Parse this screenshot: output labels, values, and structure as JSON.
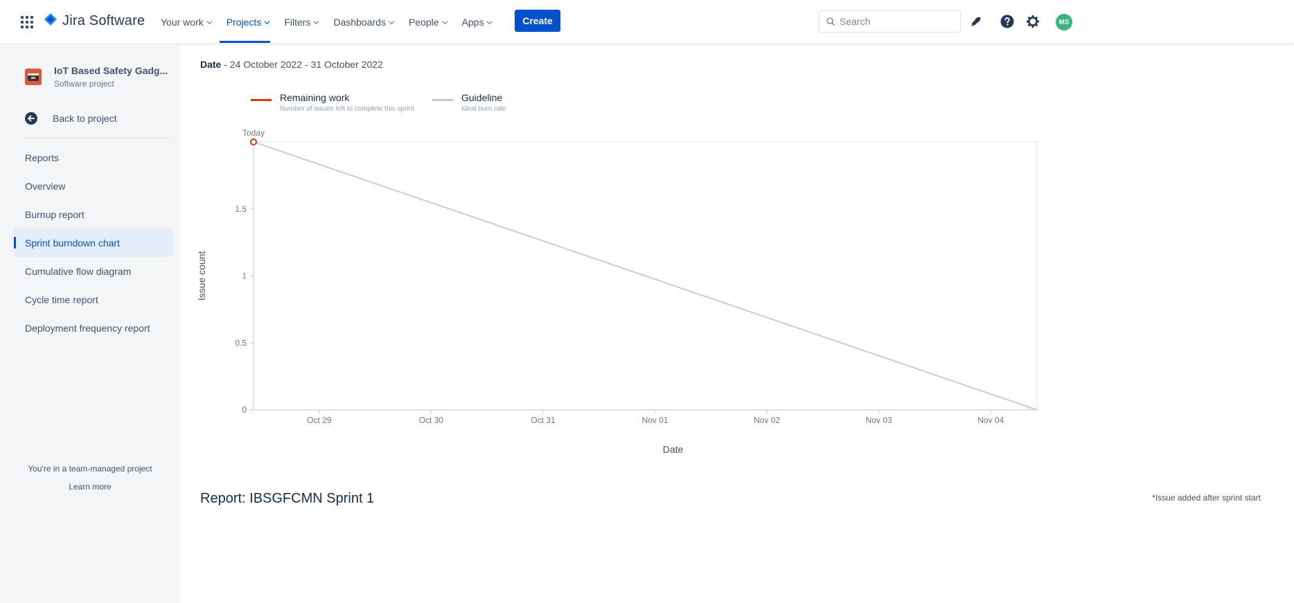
{
  "nav": {
    "product_name": "Jira Software",
    "menu": [
      {
        "label": "Your work",
        "active": false
      },
      {
        "label": "Projects",
        "active": true
      },
      {
        "label": "Filters",
        "active": false
      },
      {
        "label": "Dashboards",
        "active": false
      },
      {
        "label": "People",
        "active": false
      },
      {
        "label": "Apps",
        "active": false
      }
    ],
    "create_label": "Create",
    "search_placeholder": "Search",
    "avatar_initials": "MS",
    "icons": [
      "app-switcher-icon",
      "jira-logo-icon",
      "notifications-icon",
      "help-icon",
      "settings-icon"
    ]
  },
  "sidebar": {
    "project_name": "IoT Based Safety Gadg...",
    "project_type": "Software project",
    "back_label": "Back to project",
    "section_title": "Reports",
    "items": [
      {
        "label": "Overview",
        "active": false
      },
      {
        "label": "Burnup report",
        "active": false
      },
      {
        "label": "Sprint burndown chart",
        "active": true
      },
      {
        "label": "Cumulative flow diagram",
        "active": false
      },
      {
        "label": "Cycle time report",
        "active": false
      },
      {
        "label": "Deployment frequency report",
        "active": false
      }
    ],
    "team_note": "You're in a team-managed project",
    "learn_more": "Learn more"
  },
  "report": {
    "date_label": "Date",
    "date_range": " - 24 October 2022 - 31 October 2022",
    "legend": [
      {
        "label": "Remaining work",
        "description": "Number of issues left to complete this sprint",
        "color": "#de350b"
      },
      {
        "label": "Guideline",
        "description": "Ideal burn rate",
        "color": "#c1c7d0"
      }
    ],
    "title": "Report: IBSGFCMN Sprint 1",
    "footnote": "*Issue added after sprint start"
  },
  "chart_data": {
    "type": "line",
    "xlabel": "Date",
    "ylabel": "Issue count",
    "x_ticks": [
      "Oct 29",
      "Oct 30",
      "Oct 31",
      "Nov 01",
      "Nov 02",
      "Nov 03",
      "Nov 04"
    ],
    "y_ticks": [
      0,
      0.5,
      1,
      1.5
    ],
    "xlim": [
      "2022-10-28",
      "2022-11-04"
    ],
    "ylim": [
      0,
      2
    ],
    "today_marker": {
      "label": "Today",
      "x": "2022-10-28",
      "y": 2
    },
    "series": [
      {
        "name": "Guideline",
        "points": [
          [
            "2022-10-28",
            2
          ],
          [
            "2022-11-04",
            0
          ]
        ],
        "color": "#c9cdd3"
      },
      {
        "name": "Remaining work",
        "points": [
          [
            "2022-10-28",
            2
          ]
        ],
        "color": "#de350b"
      }
    ],
    "grid": false
  }
}
